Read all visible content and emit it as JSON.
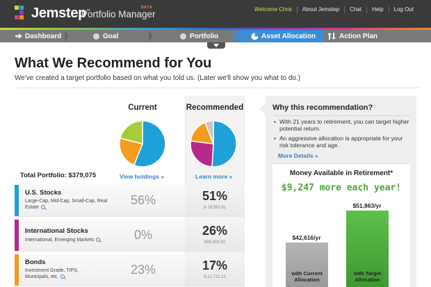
{
  "header": {
    "logo_text": "Jemstep",
    "logo_tm": "™",
    "product_name": "Portfolio Manager",
    "beta_badge": "BETA",
    "nav": [
      "Welcome Chris",
      "About Jemstep",
      "Chat",
      "Help",
      "Log Out"
    ]
  },
  "steps": [
    {
      "label": "Dashboard",
      "icon": "arrow-right-icon",
      "active": false
    },
    {
      "label": "Goal",
      "icon": "circle-icon",
      "active": false
    },
    {
      "label": "Portfolio",
      "icon": "circle-icon",
      "active": false
    },
    {
      "label": "Asset Allocation",
      "icon": "pie-icon",
      "active": true
    },
    {
      "label": "Action Plan",
      "icon": "swap-arrows-icon",
      "active": false
    }
  ],
  "page": {
    "title": "What We Recommend for You",
    "subtitle": "We've created a target portfolio based on what you told us. (Later we'll show you what to do.)"
  },
  "columns": {
    "current": "Current",
    "recommended": "Recommended"
  },
  "total_portfolio": "Total Portfolio: $379,075",
  "links": {
    "view_holdings": "View holdings »",
    "learn_more": "Learn more »",
    "more_details": "More Details »"
  },
  "colors": {
    "us": "#1ea0d8",
    "intl": "#b42a8c",
    "bonds": "#f39c1f",
    "other": "#a6cc38",
    "cash": "#c8c8c8"
  },
  "chart_data": [
    {
      "type": "pie",
      "title": "Current",
      "series": [
        {
          "name": "U.S. Stocks",
          "value": 56,
          "color": "#1ea0d8"
        },
        {
          "name": "Bonds",
          "value": 23,
          "color": "#f39c1f"
        },
        {
          "name": "Other",
          "value": 21,
          "color": "#a6cc38"
        }
      ]
    },
    {
      "type": "pie",
      "title": "Recommended",
      "series": [
        {
          "name": "U.S. Stocks",
          "value": 51,
          "color": "#1ea0d8"
        },
        {
          "name": "International Stocks",
          "value": 26,
          "color": "#b42a8c"
        },
        {
          "name": "Bonds",
          "value": 17,
          "color": "#f39c1f"
        },
        {
          "name": "Cash",
          "value": 6,
          "color": "#c8c8c8"
        }
      ]
    },
    {
      "type": "bar",
      "title": "Money Available in Retirement*",
      "categories": [
        "with Current Allocation",
        "with Target Allocation"
      ],
      "values": [
        42616,
        51863
      ],
      "data_labels": [
        "$42,616/yr",
        "$51,863/yr"
      ]
    }
  ],
  "assets": [
    {
      "name": "U.S. Stocks",
      "desc": "Large-Cap, Mid-Cap, Small-Cap, Real Estate",
      "current": "56%",
      "recommended": "51%",
      "delta": "$-19,592.81",
      "color": "#1ea0d8"
    },
    {
      "name": "International Stocks",
      "desc": "International, Emerging Markets",
      "current": "0%",
      "recommended": "26%",
      "delta": "$98,559.53",
      "color": "#b42a8c"
    },
    {
      "name": "Bonds",
      "desc": "Investment Grade, TIPS, Municipals, etc.",
      "current": "23%",
      "recommended": "17%",
      "delta": "$-21,711.23",
      "color": "#f39c1f"
    }
  ],
  "panel": {
    "title": "Why this recommendation?",
    "bullets": [
      "With 21 years to retirement, you can target higher potential return.",
      "An aggressive allocation is appropriate for your risk tolerance and age."
    ],
    "money_title": "Money Available in Retirement*",
    "money_amount": "$9,247 more each year!",
    "bar_current_value": "$42,616/yr",
    "bar_target_value": "$51,863/yr",
    "bar_current_label": "with Current Allocation",
    "bar_target_label": "with Target Allocation"
  }
}
